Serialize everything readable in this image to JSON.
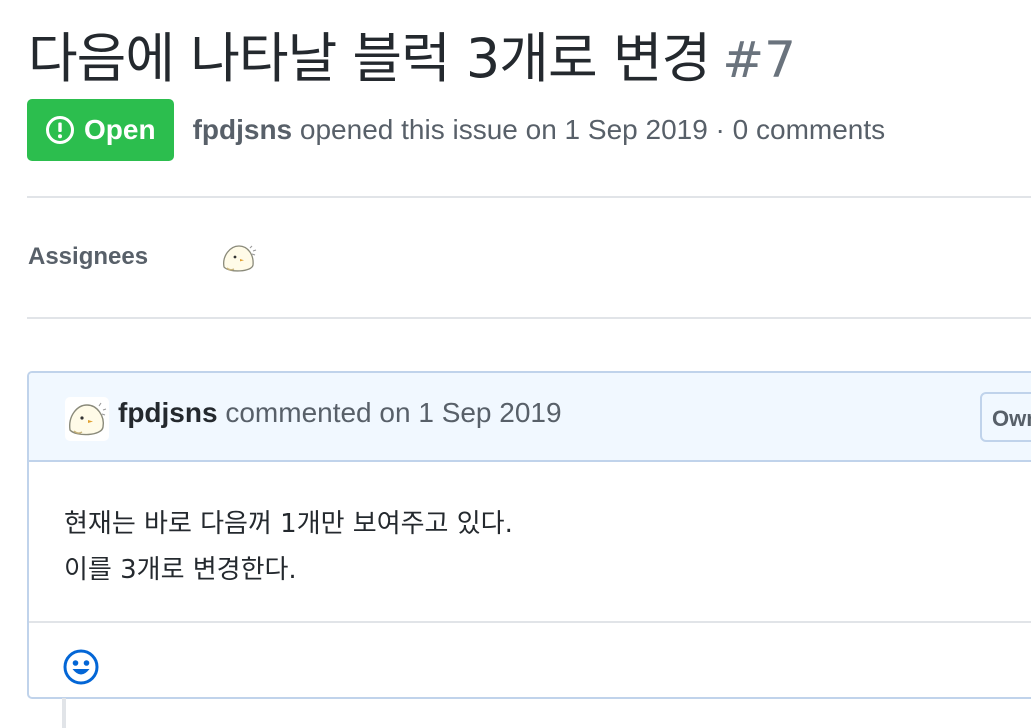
{
  "issue": {
    "title": "다음에 나타날 블럭 3개로 변경",
    "number": "#7",
    "state_label": "Open",
    "author": "fpdjsns",
    "meta_rest": "opened this issue on 1 Sep 2019 · 0 comments",
    "state_color": "#2cbe4e"
  },
  "sidebar": {
    "assignees_label": "Assignees"
  },
  "comment": {
    "author": "fpdjsns",
    "action": "commented on 1 Sep 2019",
    "badge": "Owner",
    "body": [
      "현재는 바로 다음꺼 1개만 보여주고 있다.",
      "이를 3개로 변경한다."
    ]
  },
  "icons": {
    "state": "issue-opened-icon",
    "reaction": "smiley-icon",
    "avatar": "chick-avatar"
  },
  "colors": {
    "accent_blue": "#0366d6",
    "header_bg": "#f1f8ff",
    "border_blue": "#c0d3eb"
  }
}
